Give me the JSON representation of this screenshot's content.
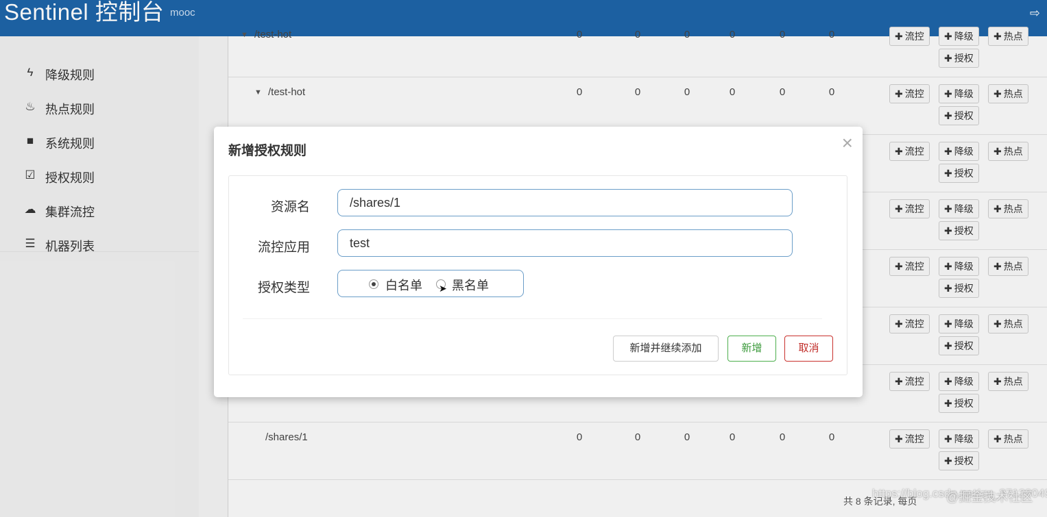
{
  "header": {
    "brand": "Sentinel 控制台",
    "brand_sub": "mooc",
    "logout_icon": "sign-out-icon"
  },
  "sidebar": {
    "items": [
      {
        "label": "降级规则",
        "icon": "bolt-icon",
        "glyph": "⚡"
      },
      {
        "label": "热点规则",
        "icon": "fire-icon",
        "glyph": "🔥"
      },
      {
        "label": "系统规则",
        "icon": "briefcase-icon",
        "glyph": "💼"
      },
      {
        "label": "授权规则",
        "icon": "check-square-icon",
        "glyph": "☑"
      },
      {
        "label": "集群流控",
        "icon": "cloud-icon",
        "glyph": "☁"
      },
      {
        "label": "机器列表",
        "icon": "list-icon",
        "glyph": "☰"
      }
    ]
  },
  "table": {
    "rows": [
      {
        "name": "/test-hot",
        "values": [
          "0",
          "0",
          "0",
          "0",
          "0",
          "0"
        ],
        "arrow": "▼"
      },
      {
        "name": "/test-hot",
        "values": [
          "0",
          "0",
          "0",
          "0",
          "0",
          "0"
        ],
        "arrow": "▼"
      },
      {
        "name": "",
        "values": [
          "",
          "",
          "",
          "",
          "",
          ""
        ],
        "arrow": ""
      },
      {
        "name": "",
        "values": [
          "",
          "",
          "",
          "",
          "",
          ""
        ],
        "arrow": ""
      },
      {
        "name": "",
        "values": [
          "",
          "",
          "",
          "",
          "",
          ""
        ],
        "arrow": ""
      },
      {
        "name": "",
        "values": [
          "",
          "",
          "",
          "",
          "",
          ""
        ],
        "arrow": ""
      },
      {
        "name": "",
        "values": [
          "",
          "",
          "",
          "",
          "",
          ""
        ],
        "arrow": ""
      },
      {
        "name": "/shares/1",
        "values": [
          "0",
          "0",
          "0",
          "0",
          "0",
          "0"
        ],
        "arrow": ""
      }
    ],
    "actions": {
      "flow": "流控",
      "degrade": "降级",
      "hot": "热点",
      "auth": "授权"
    },
    "pager": "共 8 条记录, 每页"
  },
  "watermark": "https://blog.csdn.net/qq_37128049",
  "watermark_brand": "@掘金技术社区",
  "modal": {
    "title": "新增授权规则",
    "close": "×",
    "resource_label": "资源名",
    "resource_value": "/shares/1",
    "app_label": "流控应用",
    "app_value": "test",
    "type_label": "授权类型",
    "whitelist_label": "白名单",
    "blacklist_label": "黑名单",
    "whitelist_checked": true,
    "btn_continue": "新增并继续添加",
    "btn_add": "新增",
    "btn_cancel": "取消"
  }
}
